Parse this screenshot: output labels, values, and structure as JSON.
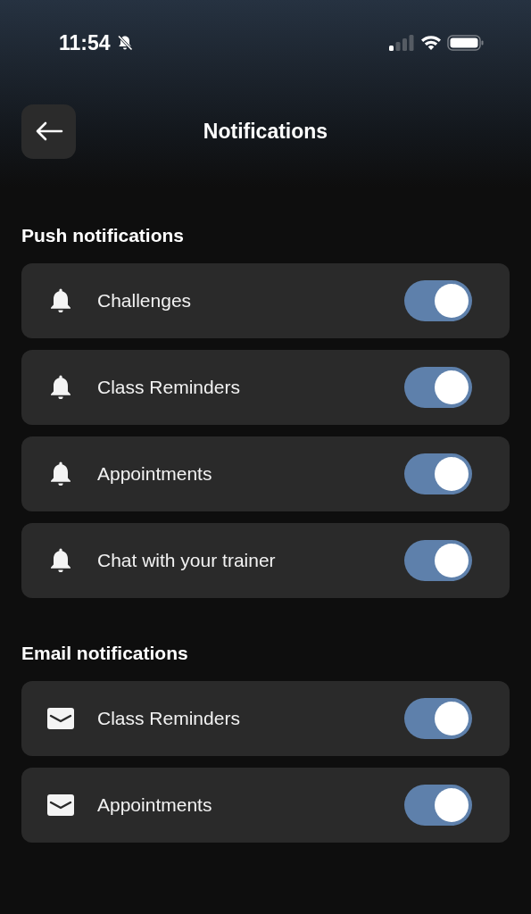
{
  "status_bar": {
    "time": "11:54"
  },
  "header": {
    "title": "Notifications"
  },
  "sections": [
    {
      "title": "Push notifications",
      "items": [
        {
          "kind": "bell",
          "label": "Challenges",
          "on": true
        },
        {
          "kind": "bell",
          "label": "Class Reminders",
          "on": true
        },
        {
          "kind": "bell",
          "label": "Appointments",
          "on": true
        },
        {
          "kind": "bell",
          "label": "Chat with your trainer",
          "on": true
        }
      ]
    },
    {
      "title": "Email notifications",
      "items": [
        {
          "kind": "mail",
          "label": "Class Reminders",
          "on": true
        },
        {
          "kind": "mail",
          "label": "Appointments",
          "on": true
        }
      ]
    }
  ]
}
